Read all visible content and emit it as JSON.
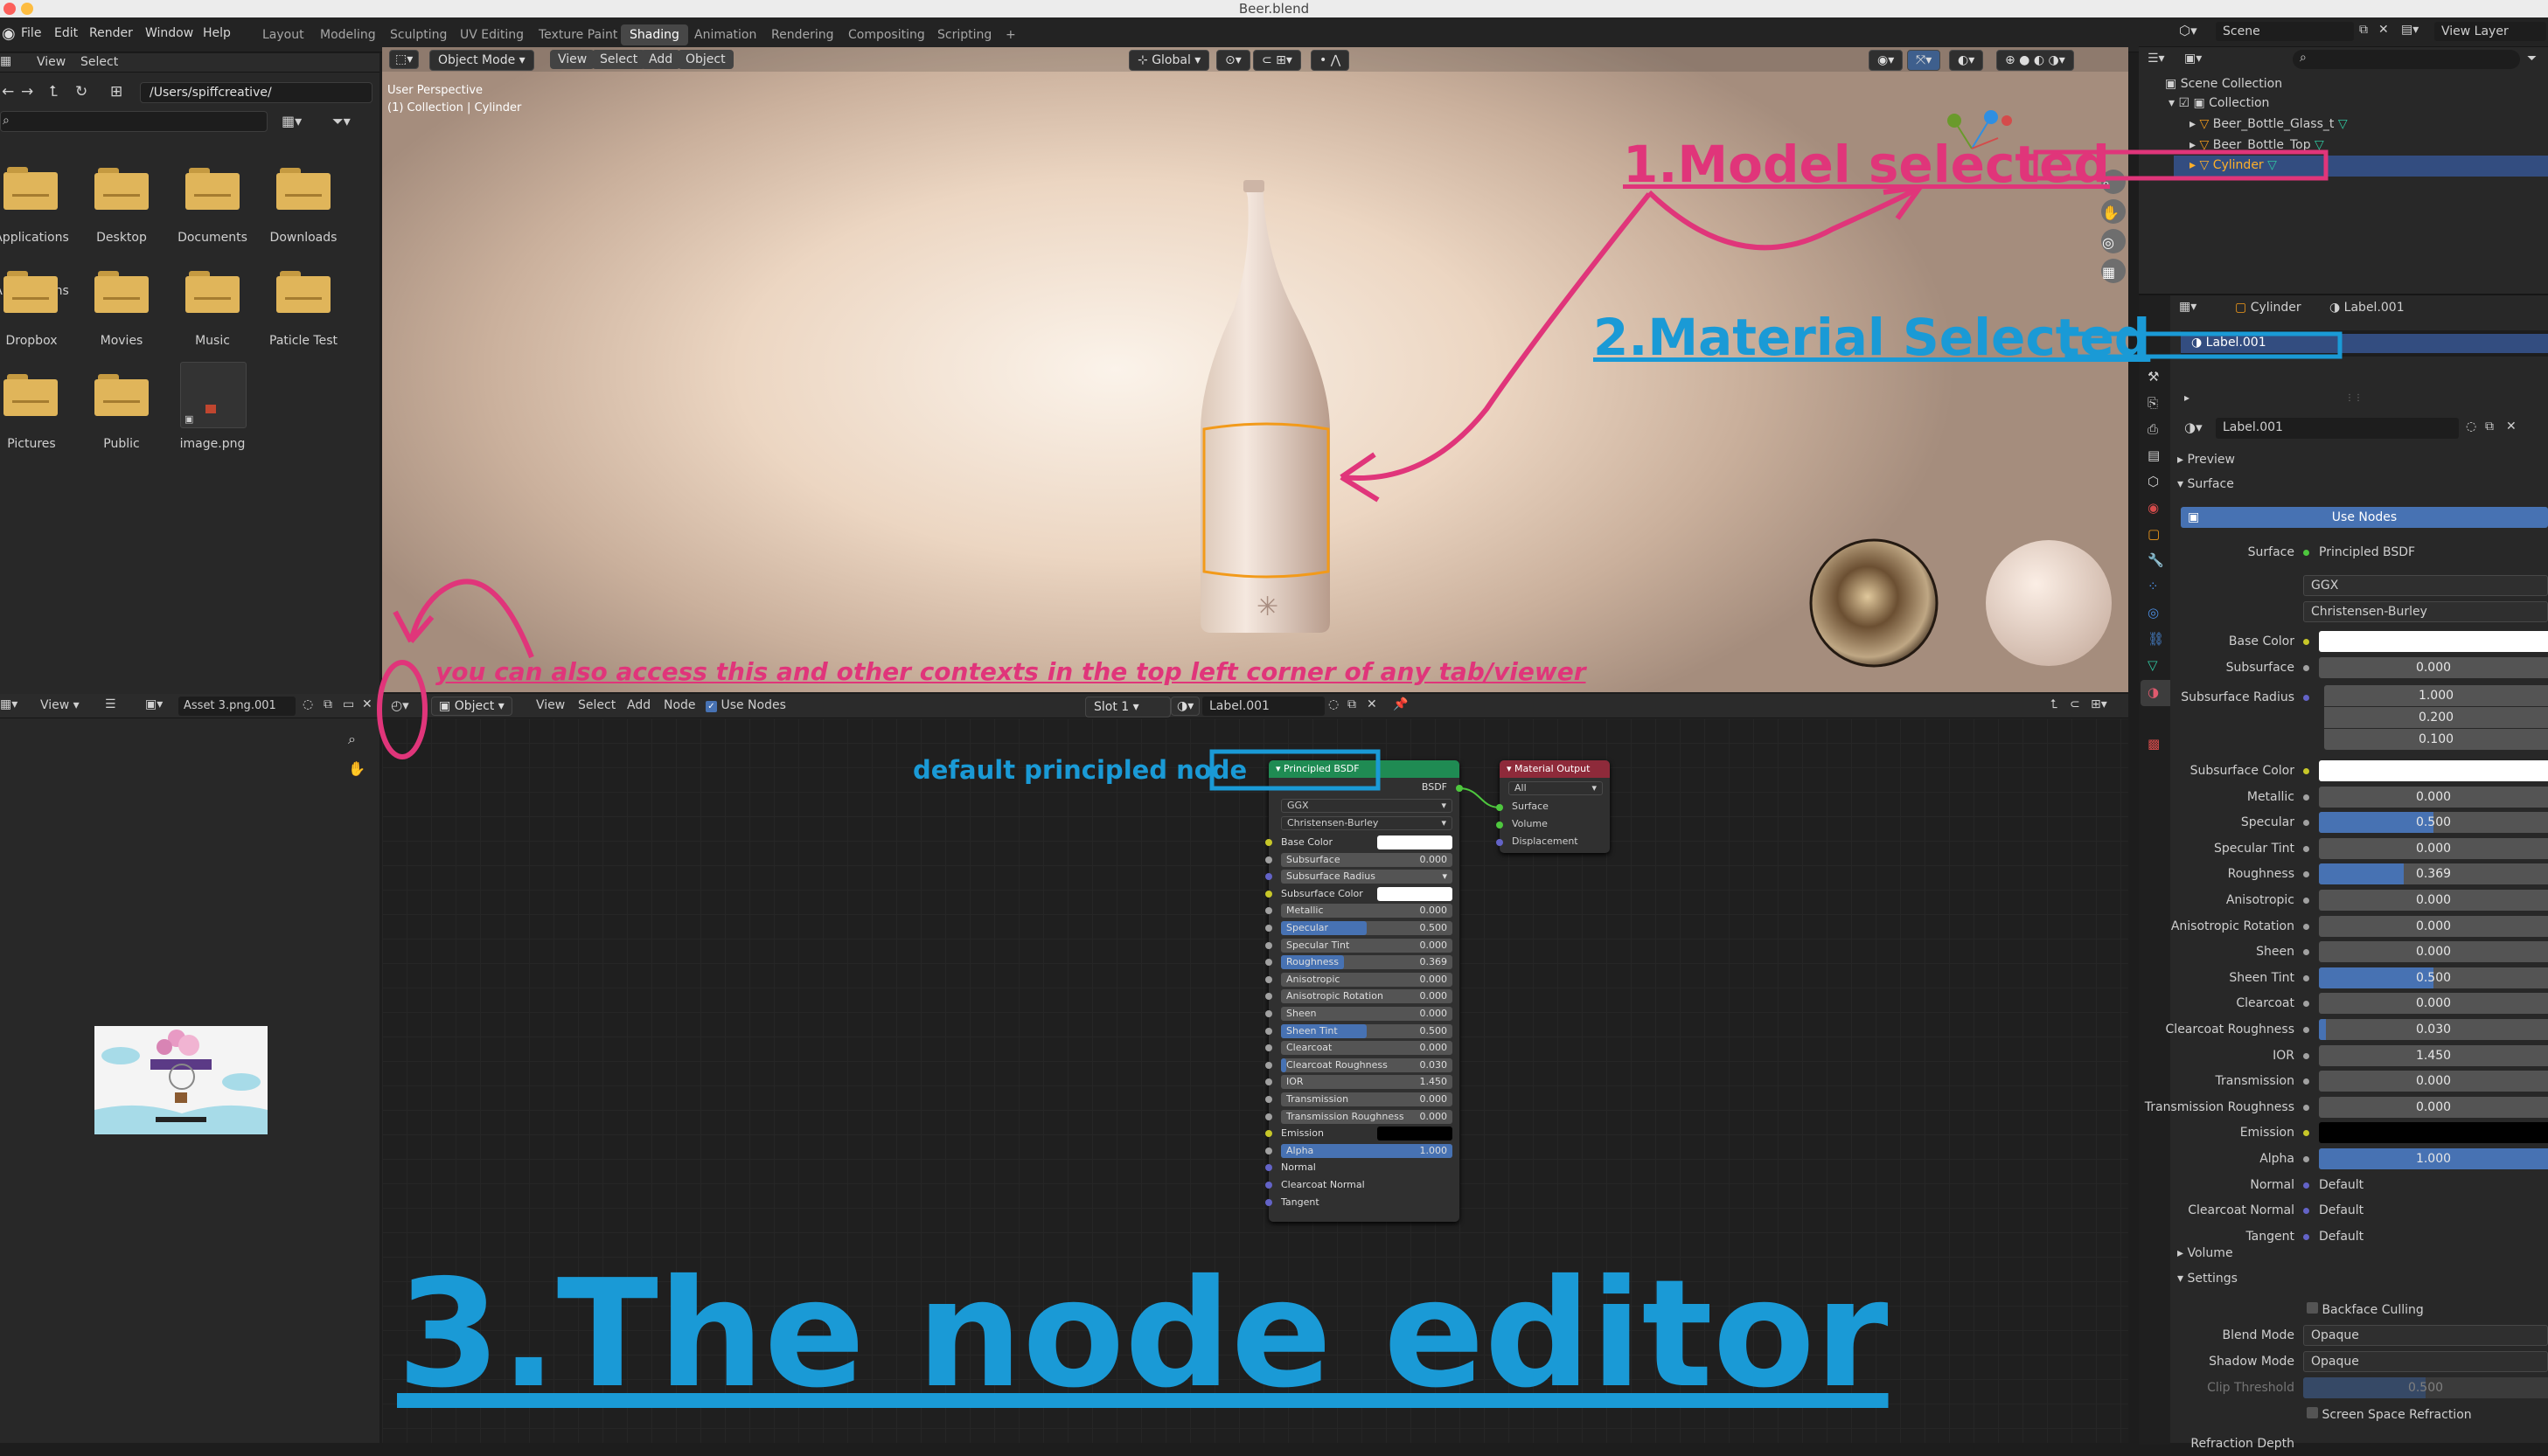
{
  "window": {
    "title": "Beer.blend"
  },
  "menu": [
    "File",
    "Edit",
    "Render",
    "Window",
    "Help"
  ],
  "workspaces": [
    "Layout",
    "Modeling",
    "Sculpting",
    "UV Editing",
    "Texture Paint",
    "Shading",
    "Animation",
    "Rendering",
    "Compositing",
    "Scripting"
  ],
  "active_workspace": "Shading",
  "file_browser": {
    "menu": [
      "View",
      "Select"
    ],
    "path": "/Users/spiffcreative/",
    "items": [
      "Applications",
      "Desktop",
      "Documents",
      "Downloads",
      "Dropbox",
      "Movies",
      "Music",
      "Paticle Test",
      "Pictures",
      "Public",
      "image.png"
    ]
  },
  "viewport": {
    "mode": "Object Mode",
    "menu": [
      "View",
      "Select",
      "Add",
      "Object"
    ],
    "overlay_title": "User Perspective",
    "overlay_sub": "(1) Collection | Cylinder",
    "orientation": "Global"
  },
  "image_editor": {
    "menu": [
      "View"
    ],
    "image_name": "Asset 3.png.001"
  },
  "node_editor": {
    "mode": "Object",
    "menu": [
      "View",
      "Select",
      "Add",
      "Node"
    ],
    "use_nodes": "Use Nodes",
    "slot": "Slot 1",
    "material": "Label.001"
  },
  "principled_node": {
    "title": "Principled BSDF",
    "output": "BSDF",
    "distribution": "GGX",
    "subsurface_method": "Christensen-Burley",
    "rows": [
      {
        "label": "Base Color",
        "type": "color",
        "dot": "#c7c729",
        "swatch": "#ffffff"
      },
      {
        "label": "Subsurface",
        "type": "value",
        "value": "0.000",
        "dot": "#a1a1a1",
        "fill": 0
      },
      {
        "label": "Subsurface Radius",
        "type": "menu",
        "dot": "#6363c7"
      },
      {
        "label": "Subsurface Color",
        "type": "color",
        "dot": "#c7c729",
        "swatch": "#ffffff"
      },
      {
        "label": "Metallic",
        "type": "value",
        "value": "0.000",
        "dot": "#a1a1a1",
        "fill": 0
      },
      {
        "label": "Specular",
        "type": "value",
        "value": "0.500",
        "dot": "#a1a1a1",
        "fill": 0.5
      },
      {
        "label": "Specular Tint",
        "type": "value",
        "value": "0.000",
        "dot": "#a1a1a1",
        "fill": 0
      },
      {
        "label": "Roughness",
        "type": "value",
        "value": "0.369",
        "dot": "#a1a1a1",
        "fill": 0.369
      },
      {
        "label": "Anisotropic",
        "type": "value",
        "value": "0.000",
        "dot": "#a1a1a1",
        "fill": 0
      },
      {
        "label": "Anisotropic Rotation",
        "type": "value",
        "value": "0.000",
        "dot": "#a1a1a1",
        "fill": 0
      },
      {
        "label": "Sheen",
        "type": "value",
        "value": "0.000",
        "dot": "#a1a1a1",
        "fill": 0
      },
      {
        "label": "Sheen Tint",
        "type": "value",
        "value": "0.500",
        "dot": "#a1a1a1",
        "fill": 0.5
      },
      {
        "label": "Clearcoat",
        "type": "value",
        "value": "0.000",
        "dot": "#a1a1a1",
        "fill": 0
      },
      {
        "label": "Clearcoat Roughness",
        "type": "value",
        "value": "0.030",
        "dot": "#a1a1a1",
        "fill": 0.03
      },
      {
        "label": "IOR",
        "type": "value",
        "value": "1.450",
        "dot": "#a1a1a1",
        "fill": 0
      },
      {
        "label": "Transmission",
        "type": "value",
        "value": "0.000",
        "dot": "#a1a1a1",
        "fill": 0
      },
      {
        "label": "Transmission Roughness",
        "type": "value",
        "value": "0.000",
        "dot": "#a1a1a1",
        "fill": 0
      },
      {
        "label": "Emission",
        "type": "color",
        "dot": "#c7c729",
        "swatch": "#000000"
      },
      {
        "label": "Alpha",
        "type": "value",
        "value": "1.000",
        "dot": "#a1a1a1",
        "fill": 1
      },
      {
        "label": "Normal",
        "type": "socket",
        "dot": "#6363c7"
      },
      {
        "label": "Clearcoat Normal",
        "type": "socket",
        "dot": "#6363c7"
      },
      {
        "label": "Tangent",
        "type": "socket",
        "dot": "#6363c7"
      }
    ]
  },
  "output_node": {
    "title": "Material Output",
    "target": "All",
    "inputs": [
      "Surface",
      "Volume",
      "Displacement"
    ]
  },
  "outliner": {
    "scene": "Scene",
    "view_layer": "View Layer",
    "items": [
      {
        "label": "Scene Collection"
      },
      {
        "label": "Collection"
      },
      {
        "label": "Beer_Bottle_Glass_t"
      },
      {
        "label": "Beer_Bottle_Top"
      },
      {
        "label": "Cylinder"
      }
    ]
  },
  "properties": {
    "object": "Cylinder",
    "material": "Label.001",
    "slot_name": "Label.001",
    "material_field": "Label.001",
    "sections": {
      "preview": "Preview",
      "surface": "Surface",
      "volume": "Volume",
      "settings": "Settings"
    },
    "use_nodes": "Use Nodes",
    "surface_label": "Surface",
    "surface_value": "Principled BSDF",
    "distribution": "GGX",
    "subsurface_method": "Christensen-Burley",
    "subsurface_radius": {
      "label": "Subsurface Radius",
      "values": [
        "1.000",
        "0.200",
        "0.100"
      ]
    },
    "rows": [
      {
        "label": "Base Color",
        "type": "color",
        "swatch": "#ffffff",
        "dot": "#c7c729"
      },
      {
        "label": "Subsurface",
        "value": "0.000",
        "fill": 0,
        "dot": "#a1a1a1"
      }
    ],
    "rows2": [
      {
        "label": "Subsurface Color",
        "type": "color",
        "swatch": "#ffffff",
        "dot": "#c7c729"
      },
      {
        "label": "Metallic",
        "value": "0.000",
        "fill": 0,
        "dot": "#a1a1a1"
      },
      {
        "label": "Specular",
        "value": "0.500",
        "fill": 0.5,
        "dot": "#a1a1a1"
      },
      {
        "label": "Specular Tint",
        "value": "0.000",
        "fill": 0,
        "dot": "#a1a1a1"
      },
      {
        "label": "Roughness",
        "value": "0.369",
        "fill": 0.369,
        "dot": "#a1a1a1"
      },
      {
        "label": "Anisotropic",
        "value": "0.000",
        "fill": 0,
        "dot": "#a1a1a1"
      },
      {
        "label": "Anisotropic Rotation",
        "value": "0.000",
        "fill": 0,
        "dot": "#a1a1a1"
      },
      {
        "label": "Sheen",
        "value": "0.000",
        "fill": 0,
        "dot": "#a1a1a1"
      },
      {
        "label": "Sheen Tint",
        "value": "0.500",
        "fill": 0.5,
        "dot": "#a1a1a1"
      },
      {
        "label": "Clearcoat",
        "value": "0.000",
        "fill": 0,
        "dot": "#a1a1a1"
      },
      {
        "label": "Clearcoat Roughness",
        "value": "0.030",
        "fill": 0.03,
        "dot": "#a1a1a1"
      },
      {
        "label": "IOR",
        "value": "1.450",
        "fill": 0,
        "dot": "#a1a1a1"
      },
      {
        "label": "Transmission",
        "value": "0.000",
        "fill": 0,
        "dot": "#a1a1a1"
      },
      {
        "label": "Transmission Roughness",
        "value": "0.000",
        "fill": 0,
        "dot": "#a1a1a1"
      },
      {
        "label": "Emission",
        "type": "color",
        "swatch": "#000000",
        "dot": "#c7c729"
      },
      {
        "label": "Alpha",
        "value": "1.000",
        "fill": 1,
        "dot": "#a1a1a1"
      },
      {
        "label": "Normal",
        "type": "link",
        "value": "Default",
        "dot": "#6363c7"
      },
      {
        "label": "Clearcoat Normal",
        "type": "link",
        "value": "Default",
        "dot": "#6363c7"
      },
      {
        "label": "Tangent",
        "type": "link",
        "value": "Default",
        "dot": "#6363c7"
      }
    ],
    "settings": {
      "backface_culling": "Backface Culling",
      "blend_mode_label": "Blend Mode",
      "blend_mode": "Opaque",
      "shadow_mode_label": "Shadow Mode",
      "shadow_mode": "Opaque",
      "clip_threshold_label": "Clip Threshold",
      "clip_threshold": "0.500",
      "screen_space_refraction": "Screen Space Refraction",
      "refraction_depth_label": "Refraction Depth"
    }
  },
  "annotations": {
    "model_selected": "1.Model selected",
    "material_selected": "2.Material Selected",
    "node_editor": "3.The node editor",
    "default_node": "default principled node",
    "contexts_hint": "you can also access this and other contexts in the top left corner of any tab/viewer"
  },
  "colors": {
    "pink": "#e0357a",
    "blue": "#1a9ad6",
    "selection": "#334d80",
    "accent": "#4772b3"
  }
}
